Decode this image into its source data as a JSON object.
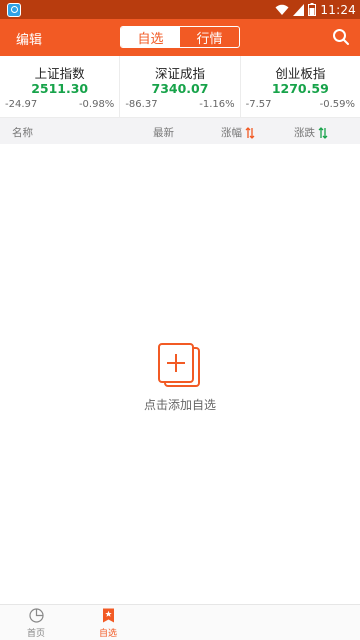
{
  "status_bar": {
    "time": "11:24"
  },
  "title_bar": {
    "edit_label": "编辑",
    "tabs": [
      {
        "label": "自选",
        "active": true
      },
      {
        "label": "行情",
        "active": false
      }
    ]
  },
  "indices": [
    {
      "name": "上证指数",
      "value": "2511.30",
      "change": "-24.97",
      "pct": "-0.98%"
    },
    {
      "name": "深证成指",
      "value": "7340.07",
      "change": "-86.37",
      "pct": "-1.16%"
    },
    {
      "name": "创业板指",
      "value": "1270.59",
      "change": "-7.57",
      "pct": "-0.59%"
    }
  ],
  "columns": {
    "name": "名称",
    "latest": "最新",
    "change_pct": "涨幅",
    "change": "涨跌"
  },
  "empty_state": {
    "text": "点击添加自选",
    "icon": "add-stock-icon"
  },
  "bottom_nav": [
    {
      "label": "首页",
      "icon": "home-pie-icon",
      "active": false
    },
    {
      "label": "自选",
      "icon": "bookmark-star-icon",
      "active": true
    }
  ],
  "colors": {
    "primary": "#f25a24",
    "status_bar": "#b83c0e",
    "index_value": "#17a34a"
  }
}
